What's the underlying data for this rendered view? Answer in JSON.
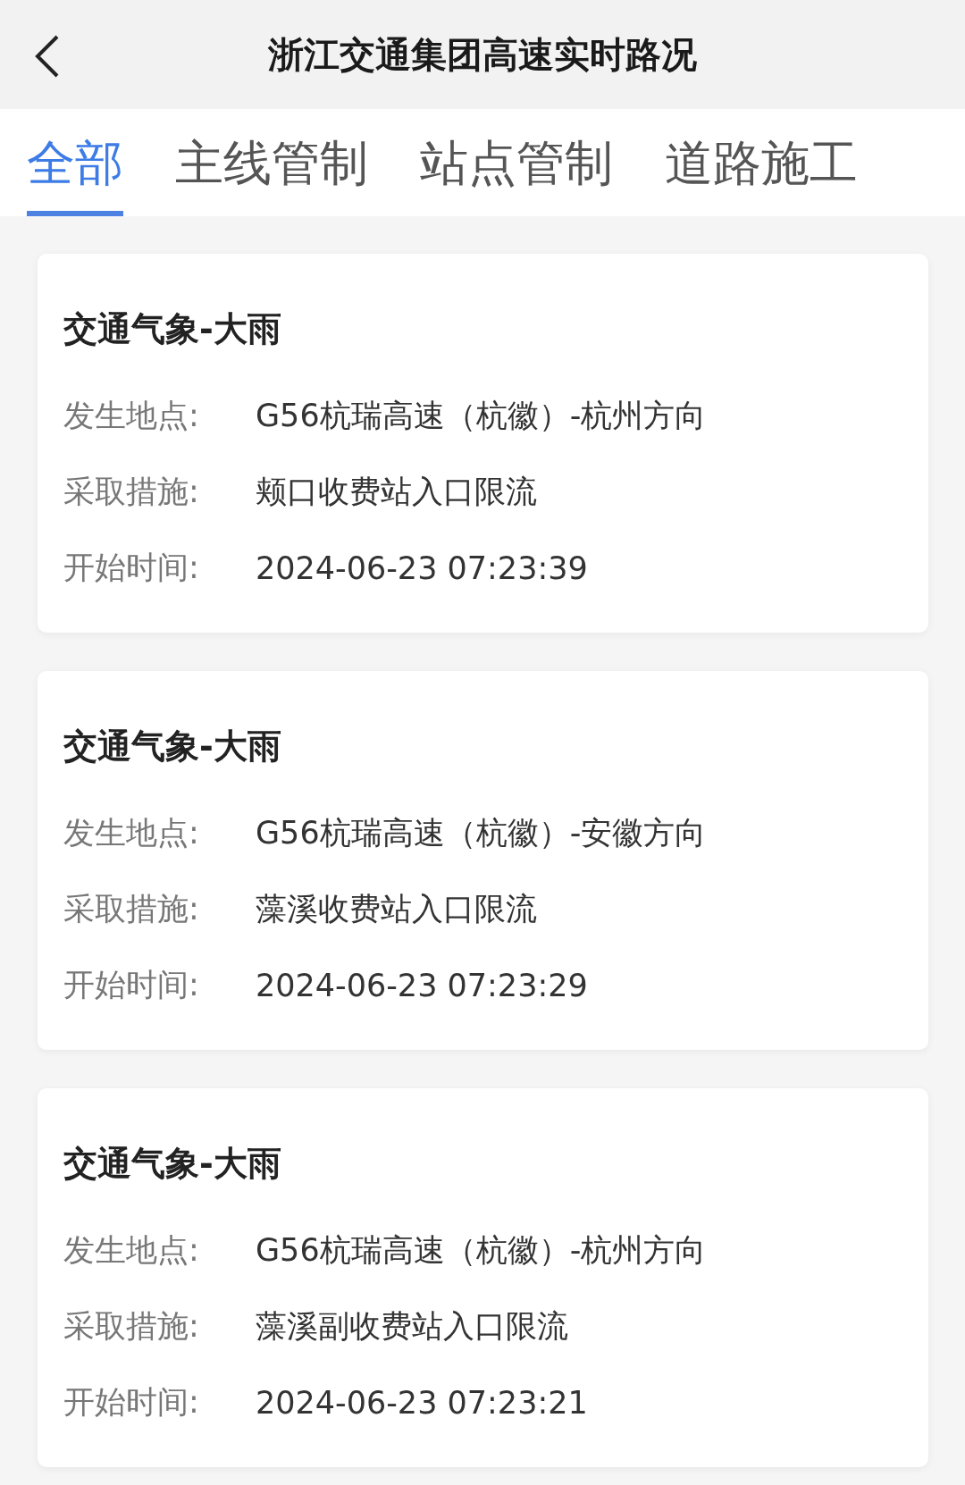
{
  "header": {
    "title": "浙江交通集团高速实时路况"
  },
  "tabs": [
    {
      "label": "全部",
      "selected": true
    },
    {
      "label": "主线管制",
      "selected": false
    },
    {
      "label": "站点管制",
      "selected": false
    },
    {
      "label": "道路施工",
      "selected": false
    }
  ],
  "cards": [
    {
      "title": "交通气象-大雨",
      "fields": [
        {
          "label": "发生地点:",
          "value": "G56杭瑞高速（杭徽）-杭州方向"
        },
        {
          "label": "采取措施:",
          "value": "颊口收费站入口限流"
        },
        {
          "label": "开始时间:",
          "value": "2024-06-23 07:23:39"
        }
      ]
    },
    {
      "title": "交通气象-大雨",
      "fields": [
        {
          "label": "发生地点:",
          "value": "G56杭瑞高速（杭徽）-安徽方向"
        },
        {
          "label": "采取措施:",
          "value": "藻溪收费站入口限流"
        },
        {
          "label": "开始时间:",
          "value": "2024-06-23 07:23:29"
        }
      ]
    },
    {
      "title": "交通气象-大雨",
      "fields": [
        {
          "label": "发生地点:",
          "value": "G56杭瑞高速（杭徽）-杭州方向"
        },
        {
          "label": "采取措施:",
          "value": "藻溪副收费站入口限流"
        },
        {
          "label": "开始时间:",
          "value": "2024-06-23 07:23:21"
        }
      ]
    }
  ]
}
